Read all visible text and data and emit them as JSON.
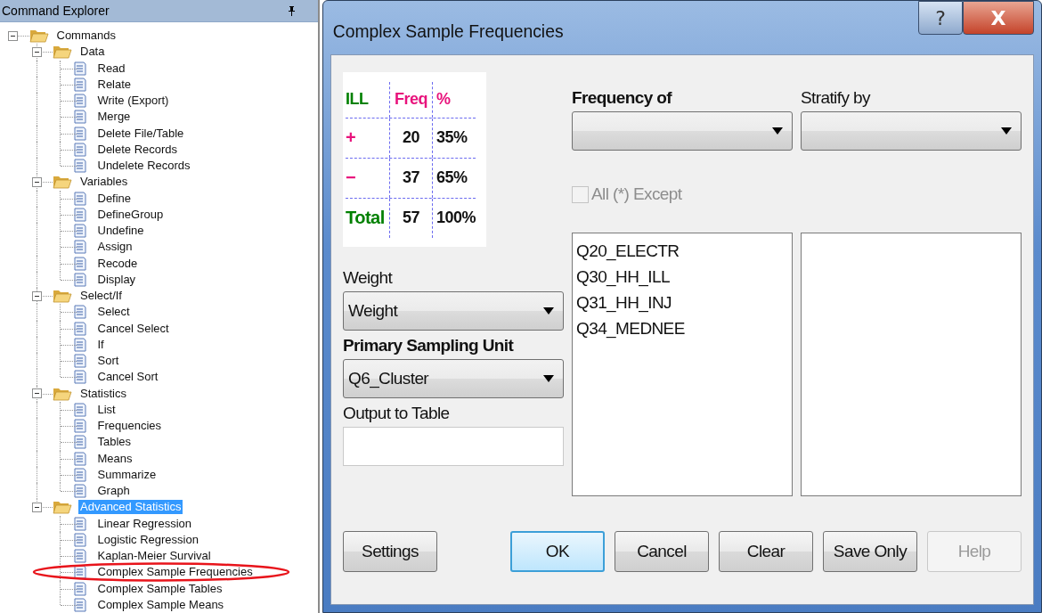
{
  "explorer": {
    "title": "Command Explorer",
    "tree": [
      {
        "label": "Commands",
        "kind": "folder",
        "expanded": true,
        "selected": false,
        "children": [
          {
            "label": "Data",
            "kind": "folder",
            "expanded": true,
            "selected": false,
            "children": [
              {
                "label": "Read",
                "kind": "command",
                "selected": false,
                "circled": false
              },
              {
                "label": "Relate",
                "kind": "command",
                "selected": false,
                "circled": false
              },
              {
                "label": "Write (Export)",
                "kind": "command",
                "selected": false,
                "circled": false
              },
              {
                "label": "Merge",
                "kind": "command",
                "selected": false,
                "circled": false
              },
              {
                "label": "Delete File/Table",
                "kind": "command",
                "selected": false,
                "circled": false
              },
              {
                "label": "Delete Records",
                "kind": "command",
                "selected": false,
                "circled": false
              },
              {
                "label": "Undelete Records",
                "kind": "command",
                "selected": false,
                "circled": false
              }
            ]
          },
          {
            "label": "Variables",
            "kind": "folder",
            "expanded": true,
            "selected": false,
            "children": [
              {
                "label": "Define",
                "kind": "command",
                "selected": false,
                "circled": false
              },
              {
                "label": "DefineGroup",
                "kind": "command",
                "selected": false,
                "circled": false
              },
              {
                "label": "Undefine",
                "kind": "command",
                "selected": false,
                "circled": false
              },
              {
                "label": "Assign",
                "kind": "command",
                "selected": false,
                "circled": false
              },
              {
                "label": "Recode",
                "kind": "command",
                "selected": false,
                "circled": false
              },
              {
                "label": "Display",
                "kind": "command",
                "selected": false,
                "circled": false
              }
            ]
          },
          {
            "label": "Select/If",
            "kind": "folder",
            "expanded": true,
            "selected": false,
            "children": [
              {
                "label": "Select",
                "kind": "command",
                "selected": false,
                "circled": false
              },
              {
                "label": "Cancel Select",
                "kind": "command",
                "selected": false,
                "circled": false
              },
              {
                "label": "If",
                "kind": "command",
                "selected": false,
                "circled": false
              },
              {
                "label": "Sort",
                "kind": "command",
                "selected": false,
                "circled": false
              },
              {
                "label": "Cancel Sort",
                "kind": "command",
                "selected": false,
                "circled": false
              }
            ]
          },
          {
            "label": "Statistics",
            "kind": "folder",
            "expanded": true,
            "selected": false,
            "children": [
              {
                "label": "List",
                "kind": "command",
                "selected": false,
                "circled": false
              },
              {
                "label": "Frequencies",
                "kind": "command",
                "selected": false,
                "circled": false
              },
              {
                "label": "Tables",
                "kind": "command",
                "selected": false,
                "circled": false
              },
              {
                "label": "Means",
                "kind": "command",
                "selected": false,
                "circled": false
              },
              {
                "label": "Summarize",
                "kind": "command",
                "selected": false,
                "circled": false
              },
              {
                "label": "Graph",
                "kind": "command",
                "selected": false,
                "circled": false
              }
            ]
          },
          {
            "label": "Advanced Statistics",
            "kind": "folder",
            "expanded": true,
            "selected": true,
            "children": [
              {
                "label": "Linear Regression",
                "kind": "command",
                "selected": false,
                "circled": false
              },
              {
                "label": "Logistic Regression",
                "kind": "command",
                "selected": false,
                "circled": false
              },
              {
                "label": "Kaplan-Meier Survival",
                "kind": "command",
                "selected": false,
                "circled": false
              },
              {
                "label": "Complex Sample Frequencies",
                "kind": "command",
                "selected": false,
                "circled": true
              },
              {
                "label": "Complex Sample Tables",
                "kind": "command",
                "selected": false,
                "circled": false
              },
              {
                "label": "Complex Sample Means",
                "kind": "command",
                "selected": false,
                "circled": false
              }
            ]
          }
        ]
      }
    ]
  },
  "dialog": {
    "title": "Complex Sample Frequencies",
    "help_glyph": "?",
    "close_glyph": "X",
    "freq_table": {
      "columns": [
        {
          "text": "ILL",
          "color": "#008000"
        },
        {
          "text": "Freq",
          "color": "#e8137c"
        },
        {
          "text": "%",
          "color": "#e8137c"
        }
      ],
      "rows": [
        {
          "label": "+",
          "color": "#e8137c",
          "freq": "20",
          "percent": "35%"
        },
        {
          "label": "−",
          "color": "#e8137c",
          "freq": "37",
          "percent": "65%"
        },
        {
          "label": "Total",
          "color": "#008000",
          "freq": "57",
          "percent": "100%"
        }
      ]
    },
    "weight": {
      "label": "Weight",
      "value": "Weight"
    },
    "primary_sampling_unit": {
      "label": "Primary Sampling Unit",
      "value": "Q6_Cluster"
    },
    "output_to_table": {
      "label": "Output to Table"
    },
    "frequency_of": {
      "label": "Frequency of"
    },
    "stratify_by": {
      "label": "Stratify by"
    },
    "all_except": {
      "label": "All (*) Except",
      "checked": false,
      "disabled": true
    },
    "variables": [
      "Q20_ELECTR",
      "Q30_HH_ILL",
      "Q31_HH_INJ",
      "Q34_MEDNEE"
    ],
    "settings_button": "Settings",
    "buttons": [
      {
        "label": "OK",
        "default": true,
        "disabled": false
      },
      {
        "label": "Cancel",
        "default": false,
        "disabled": false
      },
      {
        "label": "Clear",
        "default": false,
        "disabled": false
      },
      {
        "label": "Save Only",
        "default": false,
        "disabled": false
      },
      {
        "label": "Help",
        "default": false,
        "disabled": true
      }
    ]
  }
}
